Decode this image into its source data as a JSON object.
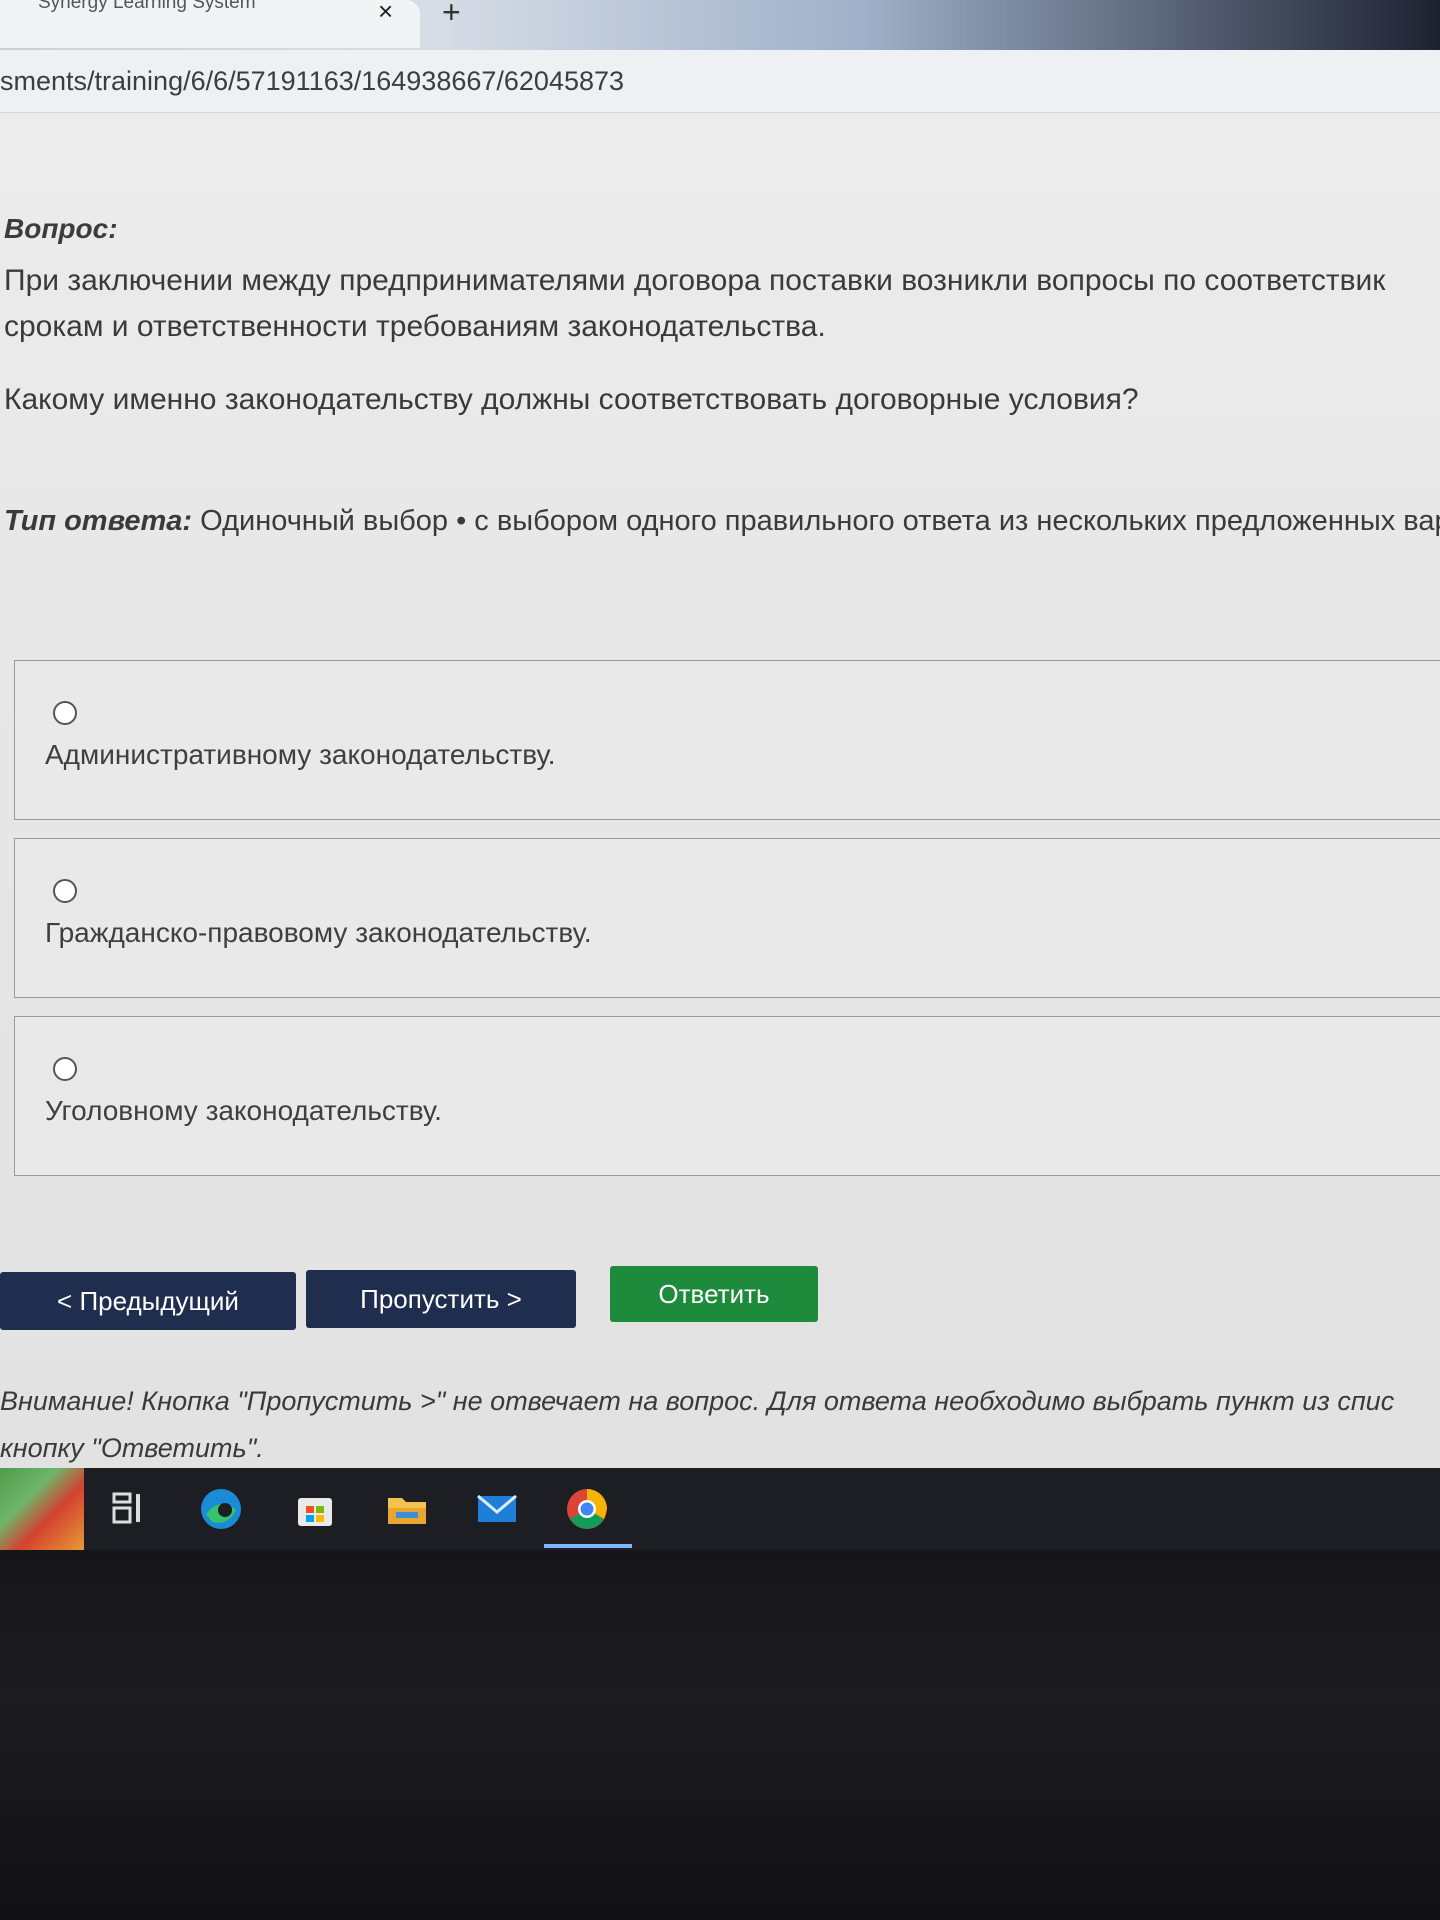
{
  "browser": {
    "tab_title": "Synergy Learning System",
    "tab_close": "×",
    "new_tab": "+",
    "url": "sments/training/6/6/57191163/164938667/62045873"
  },
  "question": {
    "label": "Вопрос:",
    "text_line1": "При заключении между предпринимателями договора поставки возникли вопросы по соответствик",
    "text_line2": "срокам и ответственности требованиям законодательства.",
    "text_question": "Какому именно законодательству должны соответствовать договорные условия?",
    "type_label": "Тип ответа:",
    "type_value": "Одиночный выбор • с выбором одного правильного ответа из нескольких предложенных вари"
  },
  "options": [
    {
      "label": "Административному законодательству.",
      "selected": false
    },
    {
      "label": "Гражданско-правовому законодательству.",
      "selected": false
    },
    {
      "label": "Уголовному законодательству.",
      "selected": false
    }
  ],
  "buttons": {
    "prev": "< Предыдущий",
    "skip": "Пропустить >",
    "answer": "Ответить"
  },
  "warning": {
    "line1": "Внимание! Кнопка \"Пропустить >\" не отвечает на вопрос. Для ответа необходимо выбрать пункт из спис",
    "line2": "кнопку \"Ответить\"."
  },
  "taskbar": {
    "icons": [
      "start-icon",
      "task-view-icon",
      "edge-icon",
      "store-icon",
      "file-explorer-icon",
      "mail-icon",
      "chrome-icon"
    ]
  },
  "colors": {
    "nav_button": "#1f2d4e",
    "answer_button": "#1e8a3c",
    "taskbar": "#1c1e24"
  }
}
